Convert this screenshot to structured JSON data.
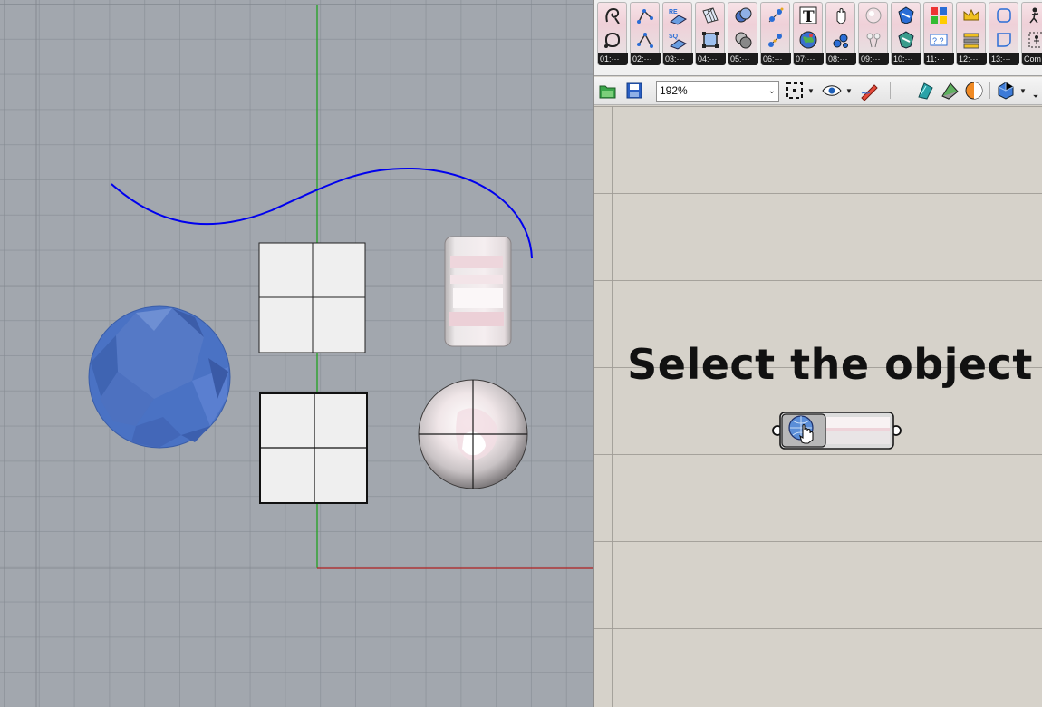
{
  "ribbon": {
    "tabs": [
      {
        "label": "01:···",
        "icon_a": "curve-edit-icon",
        "icon_b": "curve-loop-icon"
      },
      {
        "label": "02:···",
        "icon_a": "point-curve-icon",
        "icon_b": "point-curve-2-icon"
      },
      {
        "label": "03:···",
        "icon_a": "surface-re-icon",
        "icon_b": "surface-sq-icon"
      },
      {
        "label": "04:···",
        "icon_a": "mesh-icon",
        "icon_b": "frame-icon"
      },
      {
        "label": "05:···",
        "icon_a": "boolean-union-icon",
        "icon_b": "boolean-diff-icon"
      },
      {
        "label": "06:···",
        "icon_a": "chain-icon",
        "icon_b": "chain-2-icon"
      },
      {
        "label": "07:···",
        "icon_a": "text-icon",
        "icon_b": "globe-icon"
      },
      {
        "label": "08:···",
        "icon_a": "hand-icon",
        "icon_b": "bubbles-icon"
      },
      {
        "label": "09:···",
        "icon_a": "ball-icon",
        "icon_b": "flower-icon"
      },
      {
        "label": "10:···",
        "icon_a": "shield-icon",
        "icon_b": "shield-2-icon"
      },
      {
        "label": "11:···",
        "icon_a": "layout-icon",
        "icon_b": "question-box-icon"
      },
      {
        "label": "12:···",
        "icon_a": "crown-icon",
        "icon_b": "stack-icon"
      },
      {
        "label": "13:···",
        "icon_a": "rounded-square-icon",
        "icon_b": "corner-icon"
      },
      {
        "label": "Com···",
        "icon_a": "figure-icon",
        "icon_b": "figure-2-icon"
      }
    ]
  },
  "toolbar": {
    "zoom": "192%"
  },
  "canvas": {
    "prompt": "Select the object"
  },
  "colors": {
    "curve": "#0000ee",
    "gem": "#4a72c4",
    "x_axis": "#b02020",
    "y_axis": "#20a020"
  }
}
